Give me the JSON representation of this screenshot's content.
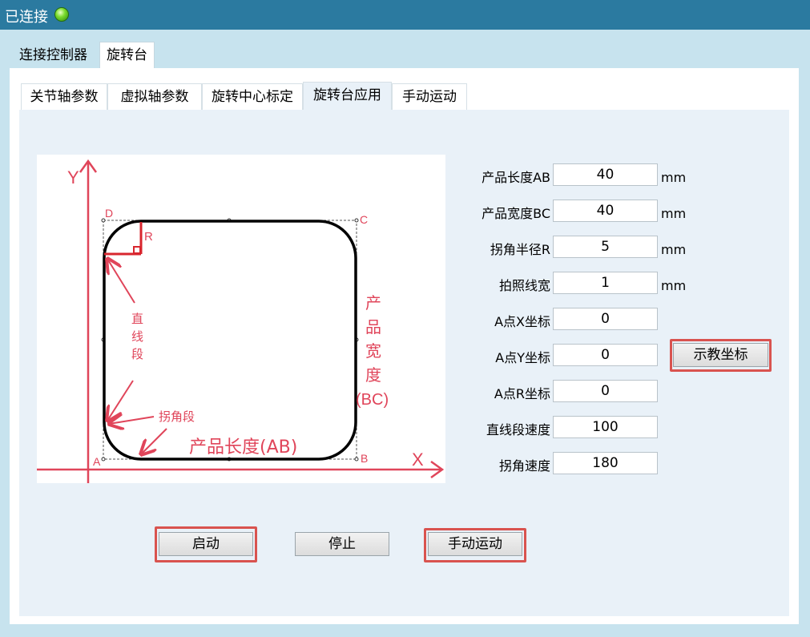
{
  "titlebar": {
    "status": "已连接"
  },
  "main_tabs": [
    "连接控制器",
    "旋转台"
  ],
  "sub_tabs": [
    "关节轴参数",
    "虚拟轴参数",
    "旋转中心标定",
    "旋转台应用",
    "手动运动"
  ],
  "diagram": {
    "y_axis": "Y",
    "x_axis": "X",
    "corner_a": "A",
    "corner_b": "B",
    "corner_c": "C",
    "corner_d": "D",
    "radius_label": "R",
    "straight_label": [
      "直",
      "线",
      "段"
    ],
    "corner_segment_label": "拐角段",
    "length_label": "产品长度(AB)",
    "width_label": [
      "产",
      "品",
      "宽",
      "度",
      "(BC)"
    ]
  },
  "fields": [
    {
      "label": "产品长度AB",
      "value": "40",
      "unit": "mm"
    },
    {
      "label": "产品宽度BC",
      "value": "40",
      "unit": "mm"
    },
    {
      "label": "拐角半径R",
      "value": "5",
      "unit": "mm"
    },
    {
      "label": "拍照线宽",
      "value": "1",
      "unit": "mm"
    },
    {
      "label": "A点X坐标",
      "value": "0",
      "unit": ""
    },
    {
      "label": "A点Y坐标",
      "value": "0",
      "unit": ""
    },
    {
      "label": "A点R坐标",
      "value": "0",
      "unit": ""
    },
    {
      "label": "直线段速度",
      "value": "100",
      "unit": ""
    },
    {
      "label": "拐角速度",
      "value": "180",
      "unit": ""
    }
  ],
  "buttons": {
    "teach": "示教坐标",
    "start": "启动",
    "stop": "停止",
    "manual": "手动运动"
  },
  "colors": {
    "titlebar": "#2b7aa0",
    "annotation": "#e0455a",
    "highlight": "#d9534f"
  }
}
